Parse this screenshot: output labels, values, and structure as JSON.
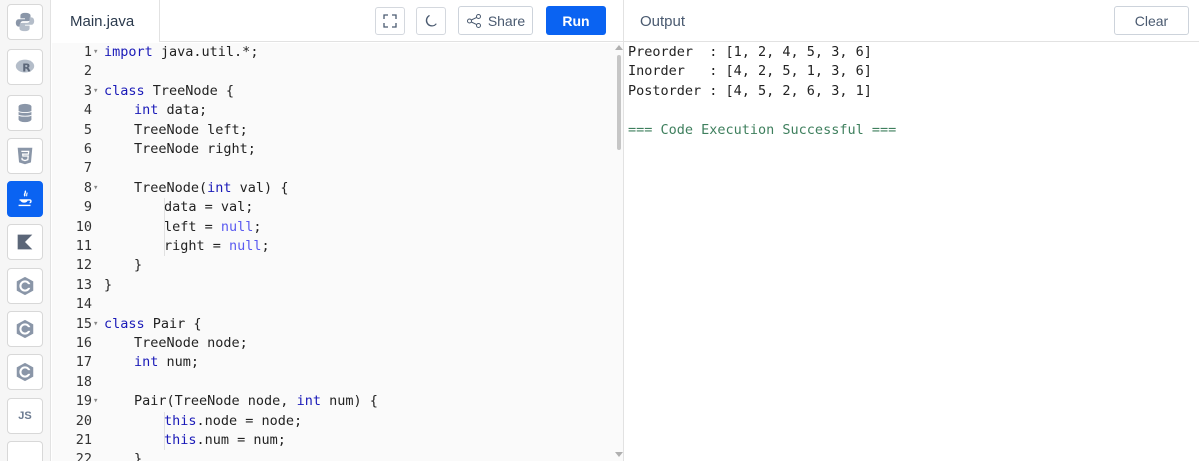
{
  "header": {
    "file_tab": "Main.java",
    "share_label": "Share",
    "run_label": "Run",
    "output_title": "Output",
    "clear_label": "Clear"
  },
  "sidebar": {
    "languages": [
      {
        "name": "python",
        "icon": "python-icon"
      },
      {
        "name": "r",
        "icon": "r-icon"
      },
      {
        "name": "sql",
        "icon": "database-icon"
      },
      {
        "name": "html",
        "icon": "html5-icon"
      },
      {
        "name": "java",
        "icon": "java-icon",
        "active": true
      },
      {
        "name": "kotlin",
        "icon": "kotlin-icon"
      },
      {
        "name": "c",
        "icon": "c-icon"
      },
      {
        "name": "csharp",
        "icon": "csharp-icon"
      },
      {
        "name": "cpp",
        "icon": "cpp-icon"
      },
      {
        "name": "js",
        "icon": "js-icon",
        "label": "JS"
      }
    ]
  },
  "editor": {
    "lines": [
      {
        "n": "1",
        "fold": true,
        "indent": 0,
        "tokens": [
          [
            "kw",
            "import"
          ],
          [
            "p",
            " java.util.*;"
          ]
        ]
      },
      {
        "n": "2",
        "fold": false,
        "indent": 0,
        "tokens": []
      },
      {
        "n": "3",
        "fold": true,
        "indent": 0,
        "tokens": [
          [
            "kw",
            "class"
          ],
          [
            "p",
            " TreeNode {"
          ]
        ]
      },
      {
        "n": "4",
        "fold": false,
        "indent": 1,
        "tokens": [
          [
            "kw",
            "int"
          ],
          [
            "p",
            " data;"
          ]
        ]
      },
      {
        "n": "5",
        "fold": false,
        "indent": 1,
        "tokens": [
          [
            "p",
            "TreeNode left;"
          ]
        ]
      },
      {
        "n": "6",
        "fold": false,
        "indent": 1,
        "tokens": [
          [
            "p",
            "TreeNode right;"
          ]
        ]
      },
      {
        "n": "7",
        "fold": false,
        "indent": 0,
        "tokens": []
      },
      {
        "n": "8",
        "fold": true,
        "indent": 1,
        "tokens": [
          [
            "p",
            "TreeNode("
          ],
          [
            "kw",
            "int"
          ],
          [
            "p",
            " val) {"
          ]
        ]
      },
      {
        "n": "9",
        "fold": false,
        "indent": 2,
        "tokens": [
          [
            "p",
            "data = val;"
          ]
        ]
      },
      {
        "n": "10",
        "fold": false,
        "indent": 2,
        "tokens": [
          [
            "p",
            "left = "
          ],
          [
            "nl",
            "null"
          ],
          [
            "p",
            ";"
          ]
        ]
      },
      {
        "n": "11",
        "fold": false,
        "indent": 2,
        "tokens": [
          [
            "p",
            "right = "
          ],
          [
            "nl",
            "null"
          ],
          [
            "p",
            ";"
          ]
        ]
      },
      {
        "n": "12",
        "fold": false,
        "indent": 1,
        "tokens": [
          [
            "p",
            "}"
          ]
        ]
      },
      {
        "n": "13",
        "fold": false,
        "indent": 0,
        "tokens": [
          [
            "p",
            "}"
          ]
        ]
      },
      {
        "n": "14",
        "fold": false,
        "indent": 0,
        "tokens": []
      },
      {
        "n": "15",
        "fold": true,
        "indent": 0,
        "tokens": [
          [
            "kw",
            "class"
          ],
          [
            "p",
            " Pair {"
          ]
        ]
      },
      {
        "n": "16",
        "fold": false,
        "indent": 1,
        "tokens": [
          [
            "p",
            "TreeNode node;"
          ]
        ]
      },
      {
        "n": "17",
        "fold": false,
        "indent": 1,
        "tokens": [
          [
            "kw",
            "int"
          ],
          [
            "p",
            " num;"
          ]
        ]
      },
      {
        "n": "18",
        "fold": false,
        "indent": 0,
        "tokens": []
      },
      {
        "n": "19",
        "fold": true,
        "indent": 1,
        "tokens": [
          [
            "p",
            "Pair(TreeNode node, "
          ],
          [
            "kw",
            "int"
          ],
          [
            "p",
            " num) {"
          ]
        ]
      },
      {
        "n": "20",
        "fold": false,
        "indent": 2,
        "tokens": [
          [
            "kw",
            "this"
          ],
          [
            "p",
            ".node = node;"
          ]
        ]
      },
      {
        "n": "21",
        "fold": false,
        "indent": 2,
        "tokens": [
          [
            "kw",
            "this"
          ],
          [
            "p",
            ".num = num;"
          ]
        ]
      },
      {
        "n": "22",
        "fold": false,
        "indent": 1,
        "tokens": [
          [
            "p",
            "}"
          ]
        ]
      }
    ]
  },
  "output": {
    "lines": [
      "Preorder  : [1, 2, 4, 5, 3, 6]",
      "Inorder   : [4, 2, 5, 1, 3, 6]",
      "Postorder : [4, 5, 2, 6, 3, 1]",
      "",
      "=== Code Execution Successful ==="
    ],
    "success_line_index": 4
  },
  "colors": {
    "accent": "#0a63f2",
    "keyword": "#1a1ab8",
    "null_literal": "#5a5af0",
    "success": "#3e7f5d"
  }
}
